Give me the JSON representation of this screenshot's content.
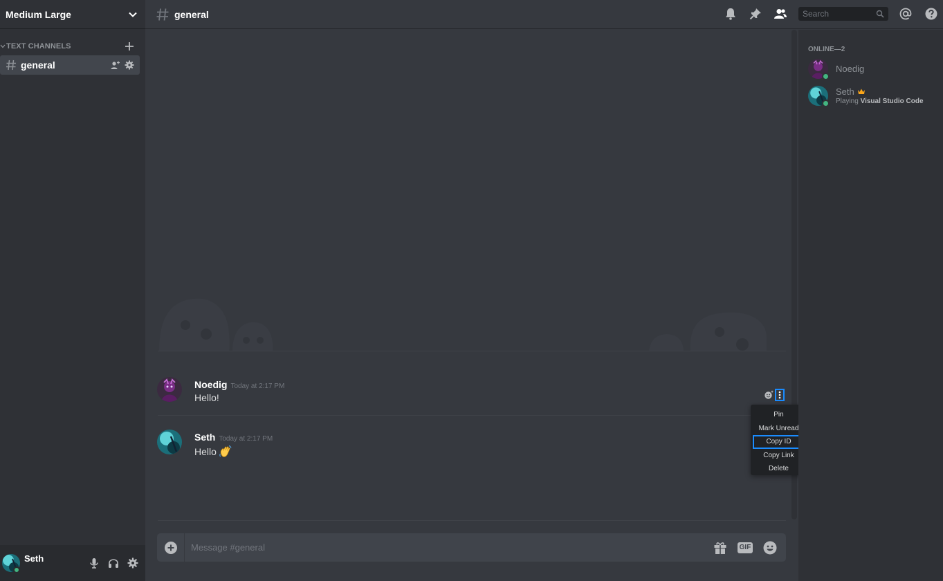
{
  "server": {
    "name": "Medium Large"
  },
  "category": {
    "label": "TEXT CHANNELS"
  },
  "channel": {
    "name": "general"
  },
  "header": {
    "title": "general",
    "search_placeholder": "Search"
  },
  "user": {
    "name": "Seth"
  },
  "messages": [
    {
      "author": "Noedig",
      "time": "Today at 2:17 PM",
      "text": "Hello!"
    },
    {
      "author": "Seth",
      "time": "Today at 2:17 PM",
      "text": "Hello"
    }
  ],
  "context_menu": {
    "items": [
      "Pin",
      "Mark Unread",
      "Copy ID",
      "Copy Link",
      "Delete"
    ],
    "active": "Copy ID"
  },
  "composer": {
    "placeholder": "Message #general",
    "gif_label": "GIF"
  },
  "members": {
    "category": "ONLINE—2",
    "list": [
      {
        "name": "Noedig",
        "activity_prefix": "",
        "activity": ""
      },
      {
        "name": "Seth",
        "activity_prefix": "Playing",
        "activity": "Visual Studio Code"
      }
    ]
  },
  "colors": {
    "online": "#43b581",
    "accent": "#1a8cff",
    "crown": "#faa61a"
  }
}
